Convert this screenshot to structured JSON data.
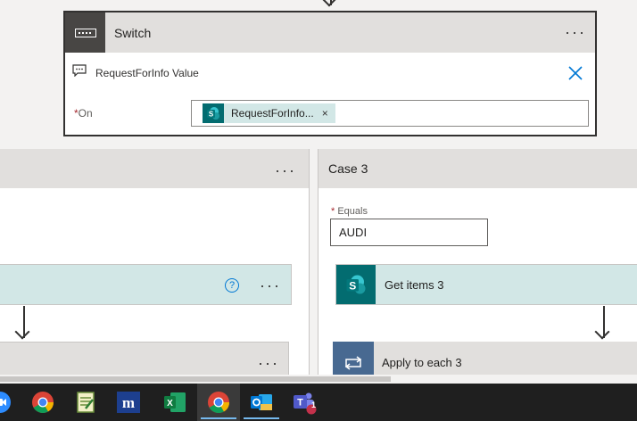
{
  "switch": {
    "title": "Switch",
    "comment": "RequestForInfo Value",
    "on_label": "On",
    "required_mark": "*",
    "token_label": "RequestForInfo...",
    "token_remove": "×",
    "close_symbol": "╳",
    "more": "···"
  },
  "left_branch": {
    "more": "···",
    "help": "?",
    "action_more": "···",
    "action2_more": "···"
  },
  "case3": {
    "title": "Case 3",
    "equals_label": "Equals",
    "required_mark": "*",
    "equals_value": "AUDI",
    "get_items_label": "Get items 3",
    "apply_each_label": "Apply to each 3"
  },
  "taskbar": {
    "items": [
      "zoom-icon",
      "chrome-icon",
      "notepad-icon",
      "monday-icon",
      "excel-icon",
      "chrome-icon",
      "outlook-icon",
      "teams-icon"
    ],
    "teams_badge": "1"
  },
  "colors": {
    "sharepoint": "#036c70",
    "loop": "#486991",
    "accent": "#0078d4",
    "required": "#a4262c"
  }
}
